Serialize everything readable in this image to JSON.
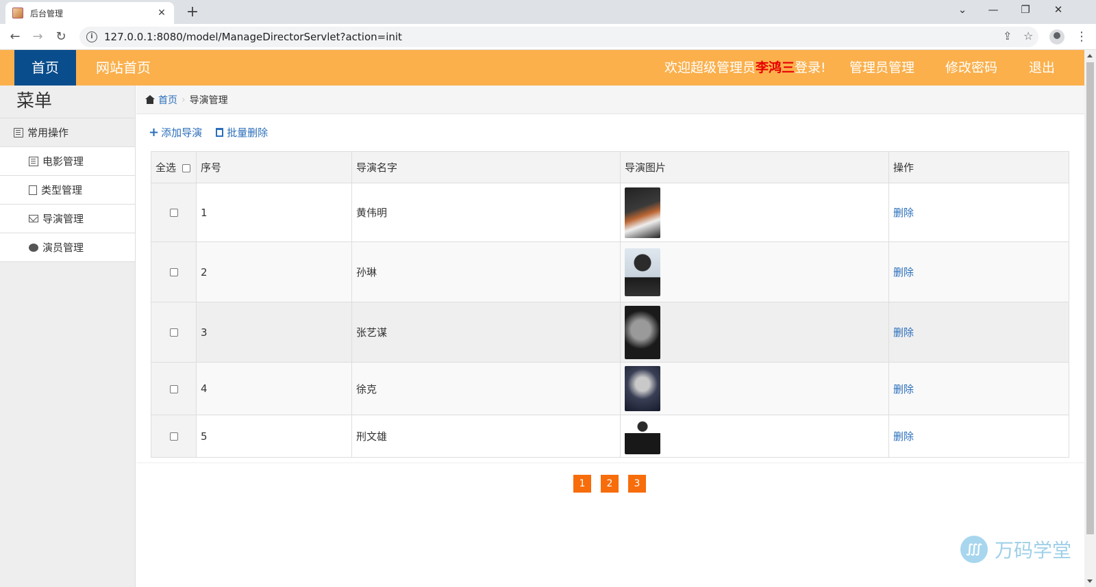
{
  "browser": {
    "tab_title": "后台管理",
    "url": "127.0.0.1:8080/model/ManageDirectorServlet?action=init"
  },
  "header": {
    "home": "首页",
    "site_home": "网站首页",
    "welcome_prefix": "欢迎超级管理员",
    "username": "李鸿三",
    "welcome_suffix": "登录!",
    "admin_manage": "管理员管理",
    "change_password": "修改密码",
    "logout": "退出"
  },
  "sidebar": {
    "title": "菜单",
    "group": "常用操作",
    "items": [
      {
        "label": "电影管理",
        "icon": "film-icon"
      },
      {
        "label": "类型管理",
        "icon": "file-icon"
      },
      {
        "label": "导演管理",
        "icon": "envelope-icon"
      },
      {
        "label": "演员管理",
        "icon": "comment-icon"
      }
    ]
  },
  "breadcrumb": {
    "home": "首页",
    "current": "导演管理"
  },
  "actions": {
    "add": "添加导演",
    "batch_delete": "批量删除"
  },
  "table": {
    "headers": {
      "select_all": "全选",
      "index": "序号",
      "name": "导演名字",
      "photo": "导演图片",
      "operation": "操作"
    },
    "rows": [
      {
        "index": "1",
        "name": "黄伟明",
        "action": "删除"
      },
      {
        "index": "2",
        "name": "孙琳",
        "action": "删除"
      },
      {
        "index": "3",
        "name": "张艺谋",
        "action": "删除"
      },
      {
        "index": "4",
        "name": "徐克",
        "action": "删除"
      },
      {
        "index": "5",
        "name": "刑文雄",
        "action": "删除"
      }
    ]
  },
  "pagination": [
    "1",
    "2",
    "3"
  ],
  "watermark": "万码学堂",
  "colors": {
    "header_bg": "#fbb04c",
    "home_bg": "#0a4d8c",
    "link": "#2a6ebb",
    "pager": "#f76c0b",
    "username": "#e80000"
  }
}
